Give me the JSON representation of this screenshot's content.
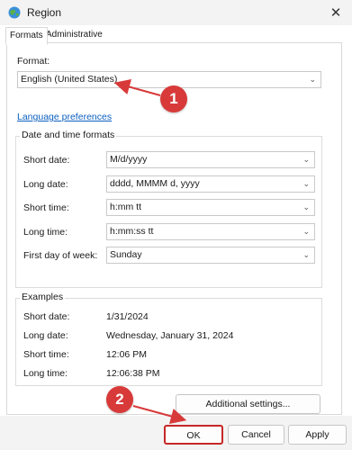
{
  "window": {
    "title": "Region",
    "close_glyph": "✕"
  },
  "tabs": [
    {
      "label": "Formats"
    },
    {
      "label": "Administrative"
    }
  ],
  "format": {
    "label": "Format:",
    "value": "English (United States)"
  },
  "language_link": "Language preferences",
  "datetime_group": {
    "title": "Date and time formats",
    "rows": [
      {
        "label": "Short date:",
        "value": "M/d/yyyy"
      },
      {
        "label": "Long date:",
        "value": "dddd, MMMM d, yyyy"
      },
      {
        "label": "Short time:",
        "value": "h:mm tt"
      },
      {
        "label": "Long time:",
        "value": "h:mm:ss tt"
      },
      {
        "label": "First day of week:",
        "value": "Sunday"
      }
    ]
  },
  "examples": {
    "title": "Examples",
    "rows": [
      {
        "label": "Short date:",
        "value": "1/31/2024"
      },
      {
        "label": "Long date:",
        "value": "Wednesday, January 31, 2024"
      },
      {
        "label": "Short time:",
        "value": "12:06 PM"
      },
      {
        "label": "Long time:",
        "value": "12:06:38 PM"
      }
    ]
  },
  "buttons": {
    "additional": "Additional settings...",
    "ok": "OK",
    "cancel": "Cancel",
    "apply": "Apply"
  },
  "callouts": {
    "one": "1",
    "two": "2"
  },
  "colors": {
    "callout": "#d83a3a",
    "link": "#0b5fbf",
    "highlight_border": "#c62828"
  }
}
